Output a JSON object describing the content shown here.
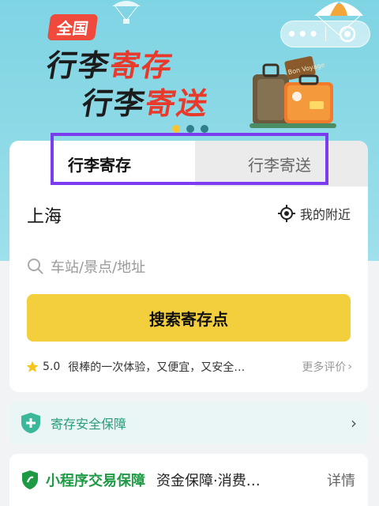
{
  "banner": {
    "badge": "全国",
    "line1_part1": "行李",
    "line1_part2": "寄存",
    "line2_part1": "行李",
    "line2_part2": "寄送",
    "luggage_tag": "Bon Voyage"
  },
  "capsule": {
    "more_icon": "more-dots-icon",
    "close_icon": "record-close-icon"
  },
  "tabs": [
    {
      "label": "行李寄存",
      "active": true
    },
    {
      "label": "行李寄送",
      "active": false
    }
  ],
  "location": {
    "city": "上海",
    "nearby_label": "我的附近"
  },
  "search": {
    "placeholder": "车站/景点/地址",
    "button_label": "搜索寄存点"
  },
  "review": {
    "score": "5.0",
    "text": "很棒的一次体验，又便宜，又安全…",
    "more_label": "更多评价"
  },
  "safety": {
    "label": "寄存安全保障"
  },
  "guarantee": {
    "title": "小程序交易保障",
    "desc": "资金保障·消费…",
    "details_label": "详情"
  },
  "colors": {
    "accent": "#f3cf3d",
    "highlight": "#7b3cf0",
    "brand_green": "#1e9a45"
  }
}
